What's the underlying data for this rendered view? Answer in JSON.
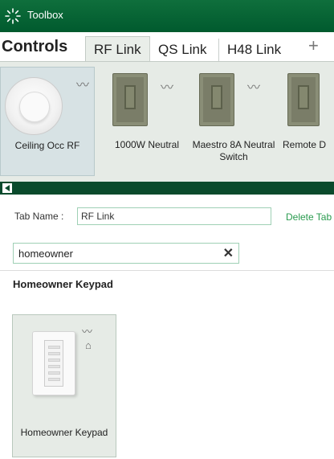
{
  "window": {
    "title": "Toolbox",
    "icon": "lutron-sunburst-icon"
  },
  "tabs": {
    "heading": "Controls",
    "items": [
      {
        "label": "RF Link",
        "active": true
      },
      {
        "label": "QS Link",
        "active": false
      },
      {
        "label": "H48 Link",
        "active": false
      }
    ],
    "add_label": "+"
  },
  "palette": {
    "devices": [
      {
        "label": "Ceiling Occ RF",
        "icon": "ceiling-occupancy-sensor-icon",
        "selected": true
      },
      {
        "label": "1000W Neutral",
        "icon": "dimmer-icon",
        "selected": false
      },
      {
        "label": "Maestro 8A Neutral Switch",
        "icon": "switch-icon",
        "selected": false
      },
      {
        "label": "Remote D",
        "icon": "remote-dimmer-icon",
        "selected": false
      }
    ],
    "wireless_icon": "wireless-signal-icon"
  },
  "tab_name": {
    "label": "Tab Name :",
    "value": "RF Link",
    "delete_label": "Delete Tab"
  },
  "search": {
    "value": "homeowner",
    "clear_label": "✕"
  },
  "results": {
    "section_title": "Homeowner Keypad",
    "items": [
      {
        "label": "Homeowner Keypad",
        "icon": "homeowner-keypad-icon"
      }
    ]
  },
  "colors": {
    "brand_green": "#005a2e",
    "accent_green": "#2a9b4f",
    "panel_bg": "#e6ebe6"
  }
}
